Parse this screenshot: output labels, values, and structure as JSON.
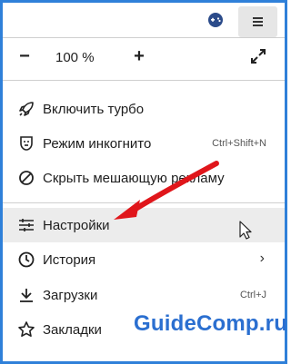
{
  "zoom": {
    "minus_label": "−",
    "plus_label": "+",
    "value": "100 %"
  },
  "menu": {
    "items": [
      {
        "label": "Включить турбо",
        "icon": "rocket-icon"
      },
      {
        "label": "Режим инкогнито",
        "icon": "incognito-icon",
        "shortcut": "Ctrl+Shift+N"
      },
      {
        "label": "Скрыть мешающую рекламу",
        "icon": "block-icon"
      },
      {
        "label": "Настройки",
        "icon": "settings-sliders-icon"
      },
      {
        "label": "История",
        "icon": "history-clock-icon"
      },
      {
        "label": "Загрузки",
        "icon": "download-icon",
        "shortcut": "Ctrl+J"
      },
      {
        "label": "Закладки",
        "icon": "star-icon"
      }
    ]
  },
  "watermark": "GuideComp.ru",
  "colors": {
    "frame": "#2f80d9",
    "arrow": "#e0161b",
    "highlight": "#ececec",
    "watermark": "#2b6fd0"
  }
}
